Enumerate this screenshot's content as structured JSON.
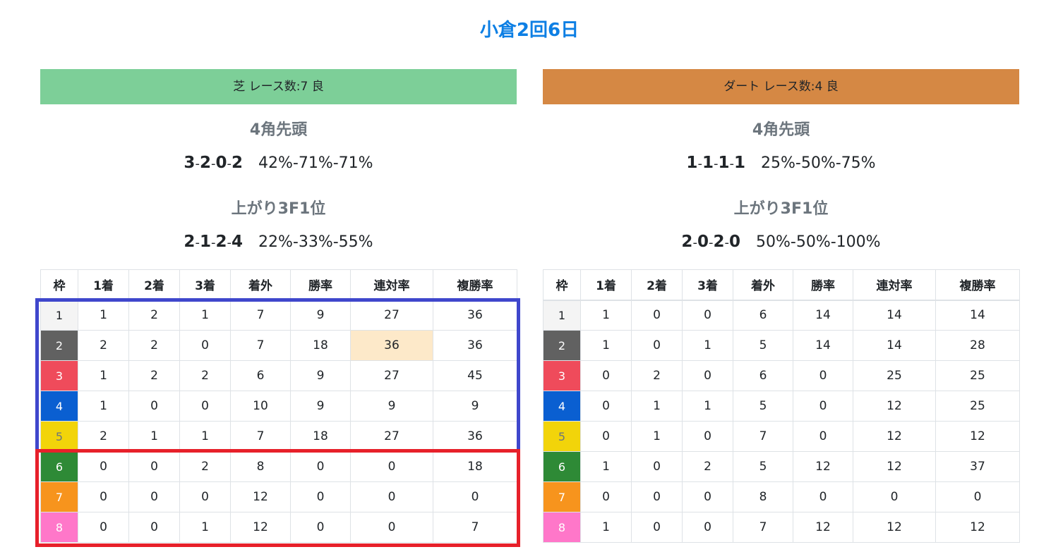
{
  "page_title": "小倉2回6日",
  "panels": [
    {
      "surface_label": "芝 レース数:7 良",
      "surface_color": "#7dcf98",
      "sections": [
        {
          "heading": "4角先頭",
          "record": [
            "3",
            "2",
            "0",
            "2"
          ],
          "rate": "42%-71%-71%"
        },
        {
          "heading": "上がり3F1位",
          "record": [
            "2",
            "1",
            "2",
            "4"
          ],
          "rate": "22%-33%-55%"
        }
      ],
      "headers": [
        "枠",
        "1着",
        "2着",
        "3着",
        "着外",
        "勝率",
        "連対率",
        "複勝率"
      ],
      "rows": [
        [
          "1",
          "1",
          "2",
          "1",
          "7",
          "9",
          "27",
          "36"
        ],
        [
          "2",
          "2",
          "2",
          "0",
          "7",
          "18",
          "36",
          "36"
        ],
        [
          "3",
          "1",
          "2",
          "2",
          "6",
          "9",
          "27",
          "45"
        ],
        [
          "4",
          "1",
          "0",
          "0",
          "10",
          "9",
          "9",
          "9"
        ],
        [
          "5",
          "2",
          "1",
          "1",
          "7",
          "18",
          "27",
          "36"
        ],
        [
          "6",
          "0",
          "0",
          "2",
          "8",
          "0",
          "0",
          "18"
        ],
        [
          "7",
          "0",
          "0",
          "0",
          "12",
          "0",
          "0",
          "0"
        ],
        [
          "8",
          "0",
          "0",
          "1",
          "12",
          "0",
          "0",
          "7"
        ]
      ],
      "highlighted_cells": [
        [
          1,
          6
        ]
      ]
    },
    {
      "surface_label": "ダート レース数:4 良",
      "surface_color": "#d58844",
      "sections": [
        {
          "heading": "4角先頭",
          "record": [
            "1",
            "1",
            "1",
            "1"
          ],
          "rate": "25%-50%-75%"
        },
        {
          "heading": "上がり3F1位",
          "record": [
            "2",
            "0",
            "2",
            "0"
          ],
          "rate": "50%-50%-100%"
        }
      ],
      "headers": [
        "枠",
        "1着",
        "2着",
        "3着",
        "着外",
        "勝率",
        "連対率",
        "複勝率"
      ],
      "rows": [
        [
          "1",
          "1",
          "0",
          "0",
          "6",
          "14",
          "14",
          "14"
        ],
        [
          "2",
          "1",
          "0",
          "1",
          "5",
          "14",
          "14",
          "28"
        ],
        [
          "3",
          "0",
          "2",
          "0",
          "6",
          "0",
          "25",
          "25"
        ],
        [
          "4",
          "0",
          "1",
          "1",
          "5",
          "0",
          "12",
          "25"
        ],
        [
          "5",
          "0",
          "1",
          "0",
          "7",
          "0",
          "12",
          "12"
        ],
        [
          "6",
          "1",
          "0",
          "2",
          "5",
          "12",
          "12",
          "37"
        ],
        [
          "7",
          "0",
          "0",
          "0",
          "8",
          "0",
          "0",
          "0"
        ],
        [
          "8",
          "1",
          "0",
          "0",
          "7",
          "12",
          "12",
          "12"
        ]
      ],
      "highlighted_cells": []
    }
  ],
  "frame_colors": [
    {
      "bg": "#f4f4f4",
      "fg": "#212529"
    },
    {
      "bg": "#616161",
      "fg": "#ffffff"
    },
    {
      "bg": "#ef4b5b",
      "fg": "#ffffff"
    },
    {
      "bg": "#0a5fd1",
      "fg": "#ffffff"
    },
    {
      "bg": "#f2d40a",
      "fg": "#6c757d"
    },
    {
      "bg": "#2e8a36",
      "fg": "#ffffff"
    },
    {
      "bg": "#f7941d",
      "fg": "#ffffff"
    },
    {
      "bg": "#ff77c9",
      "fg": "#ffffff"
    }
  ],
  "annotation_colors": {
    "blue": "#3f47cc",
    "red": "#e7202a"
  }
}
